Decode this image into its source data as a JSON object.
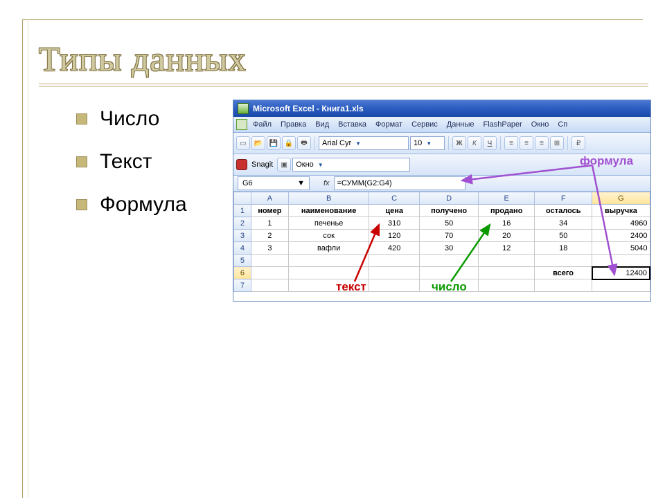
{
  "slide": {
    "title": "Типы данных",
    "bullets": [
      "Число",
      "Текст",
      "Формула"
    ]
  },
  "excel": {
    "app_title": "Microsoft Excel - Книга1.xls",
    "menus": [
      "Файл",
      "Правка",
      "Вид",
      "Вставка",
      "Формат",
      "Сервис",
      "Данные",
      "FlashPaper",
      "Окно",
      "Сп"
    ],
    "font_name": "Arial Cyr",
    "font_size": "10",
    "snagit_label": "Snagit",
    "snagit_window": "Окно",
    "buttons": {
      "bold": "Ж",
      "italic": "К",
      "underline": "Ч"
    },
    "name_box": "G6",
    "fx_label": "fx",
    "formula": "=СУММ(G2:G4)",
    "columns": [
      "",
      "A",
      "B",
      "C",
      "D",
      "E",
      "F",
      "G"
    ],
    "headers": [
      "номер",
      "наименование",
      "цена",
      "получено",
      "продано",
      "осталось",
      "выручка"
    ],
    "rows": [
      {
        "n": "1",
        "name": "печенье",
        "price": "310",
        "received": "50",
        "sold": "16",
        "left": "34",
        "rev": "4960"
      },
      {
        "n": "2",
        "name": "сок",
        "price": "120",
        "received": "70",
        "sold": "20",
        "left": "50",
        "rev": "2400"
      },
      {
        "n": "3",
        "name": "вафли",
        "price": "420",
        "received": "30",
        "sold": "12",
        "left": "18",
        "rev": "5040"
      }
    ],
    "total_label": "всего",
    "total_value": "12400",
    "annotations": {
      "text": "текст",
      "number": "число",
      "formula": "формула"
    }
  },
  "chart_data": {
    "type": "table",
    "columns": [
      "номер",
      "наименование",
      "цена",
      "получено",
      "продано",
      "осталось",
      "выручка"
    ],
    "rows": [
      [
        1,
        "печенье",
        310,
        50,
        16,
        34,
        4960
      ],
      [
        2,
        "сок",
        120,
        70,
        20,
        50,
        2400
      ],
      [
        3,
        "вафли",
        420,
        30,
        12,
        18,
        5040
      ]
    ],
    "totals": {
      "выручка": 12400
    },
    "selected_cell": "G6",
    "selected_cell_formula": "=СУММ(G2:G4)"
  }
}
